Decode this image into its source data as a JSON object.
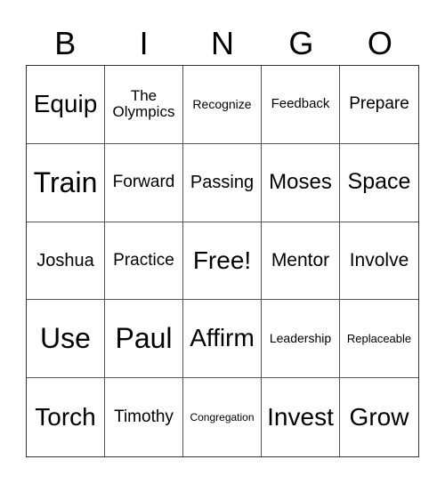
{
  "header": [
    "B",
    "I",
    "N",
    "G",
    "O"
  ],
  "cells": [
    [
      "Equip",
      "The Olympics",
      "Recognize",
      "Feedback",
      "Prepare"
    ],
    [
      "Train",
      "Forward",
      "Passing",
      "Moses",
      "Space"
    ],
    [
      "Joshua",
      "Practice",
      "Free!",
      "Mentor",
      "Involve"
    ],
    [
      "Use",
      "Paul",
      "Affirm",
      "Leadership",
      "Replaceable"
    ],
    [
      "Torch",
      "Timothy",
      "Congregation",
      "Invest",
      "Grow"
    ]
  ]
}
